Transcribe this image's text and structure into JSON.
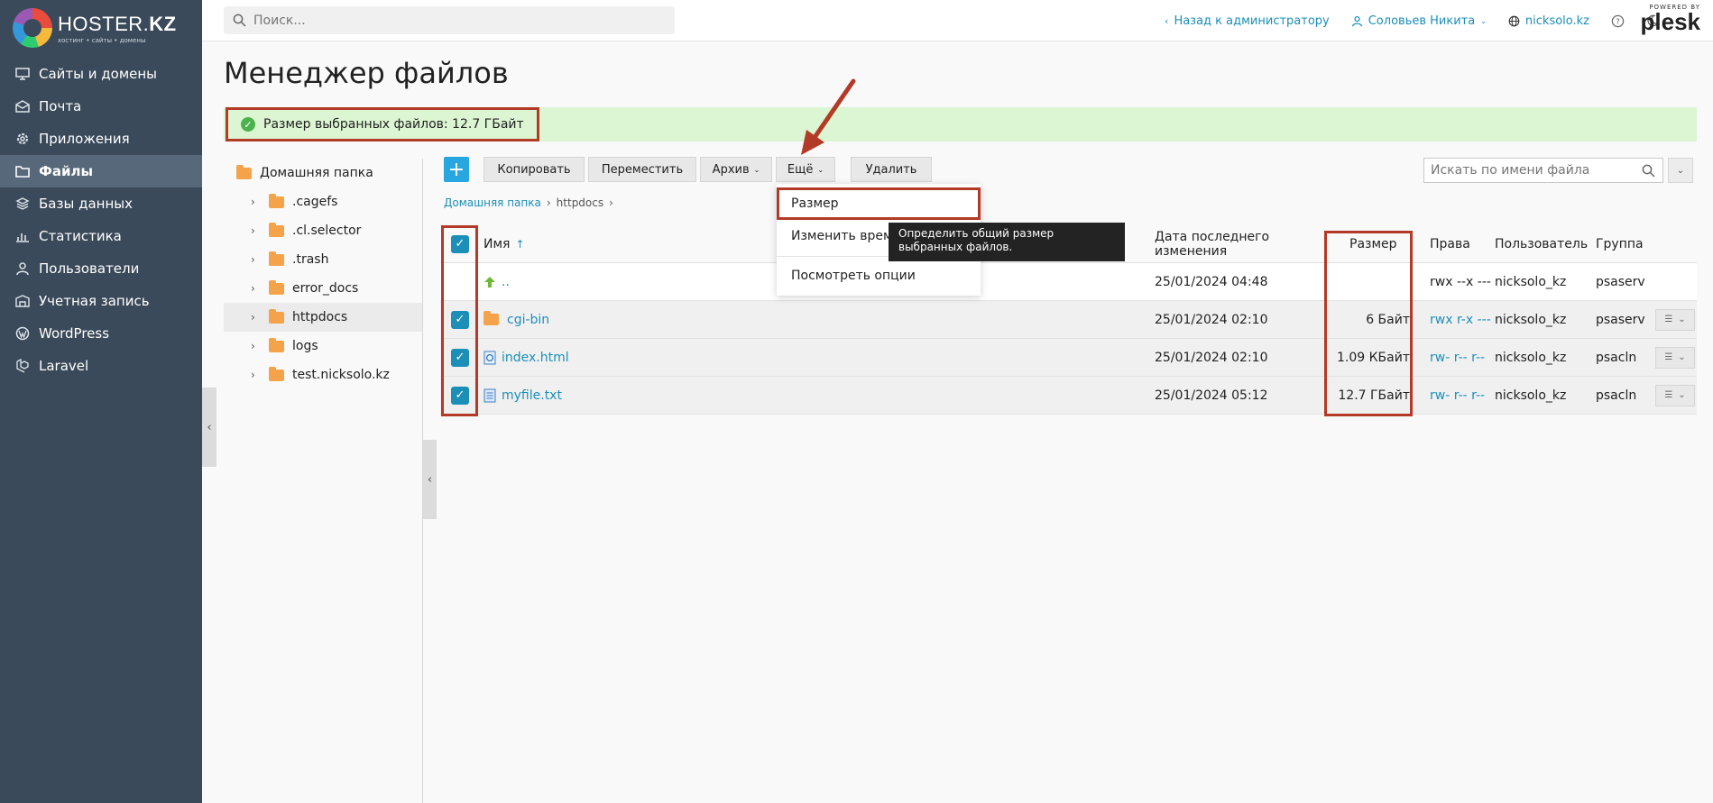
{
  "brand": {
    "logo_main": "HOSTER.",
    "logo_bold": "KZ",
    "logo_sub": "хостинг • сайты • домены"
  },
  "sidebar": {
    "items": [
      {
        "label": "Сайты и домены",
        "icon": "monitor-icon"
      },
      {
        "label": "Почта",
        "icon": "mail-icon"
      },
      {
        "label": "Приложения",
        "icon": "gear-icon"
      },
      {
        "label": "Файлы",
        "icon": "folder-icon",
        "active": true
      },
      {
        "label": "Базы данных",
        "icon": "database-icon"
      },
      {
        "label": "Статистика",
        "icon": "bar-chart-icon"
      },
      {
        "label": "Пользователи",
        "icon": "user-icon"
      },
      {
        "label": "Учетная запись",
        "icon": "account-icon"
      },
      {
        "label": "WordPress",
        "icon": "wordpress-icon"
      },
      {
        "label": "Laravel",
        "icon": "laravel-icon"
      }
    ]
  },
  "header": {
    "search_placeholder": "Поиск...",
    "back_link": "Назад к администратору",
    "user_name": "Соловьев Никита",
    "domain": "nicksolo.kz",
    "powered_by": "POWERED BY",
    "plesk": "plesk"
  },
  "page": {
    "title": "Менеджер файлов",
    "success_message": "Размер выбранных файлов: 12.7 ГБайт"
  },
  "tree": {
    "root": "Домашняя папка",
    "children": [
      ".cagefs",
      ".cl.selector",
      ".trash",
      "error_docs",
      "httpdocs",
      "logs",
      "test.nicksolo.kz"
    ],
    "selected": "httpdocs"
  },
  "toolbar": {
    "add": "+",
    "copy": "Копировать",
    "move": "Переместить",
    "archive": "Архив",
    "more": "Ещё",
    "delete": "Удалить",
    "file_search_placeholder": "Искать по имени файла"
  },
  "breadcrumb": {
    "home": "Домашняя папка",
    "current": "httpdocs"
  },
  "table": {
    "headers": {
      "name": "Имя",
      "date": "Дата последнего изменения",
      "size": "Размер",
      "perms": "Права",
      "user": "Пользователь",
      "group": "Группа"
    },
    "rows": [
      {
        "name": "..",
        "date": "25/01/2024 04:48",
        "size": "",
        "perms": "rwx --x ---",
        "user": "nicksolo_kz",
        "group": "psaserv"
      },
      {
        "name": "cgi-bin",
        "date": "25/01/2024 02:10",
        "size": "6 Байт",
        "perms": "rwx r-x ---",
        "user": "nicksolo_kz",
        "group": "psaserv"
      },
      {
        "name": "index.html",
        "date": "25/01/2024 02:10",
        "size": "1.09 КБайт",
        "perms": "rw- r-- r--",
        "user": "nicksolo_kz",
        "group": "psacln"
      },
      {
        "name": "myfile.txt",
        "date": "25/01/2024 05:12",
        "size": "12.7 ГБайт",
        "perms": "rw- r-- r--",
        "user": "nicksolo_kz",
        "group": "psacln"
      }
    ]
  },
  "dropdown": {
    "size": "Размер",
    "change_time": "Изменить врем",
    "view_options": "Посмотреть опции"
  },
  "tooltip": {
    "text": "Определить общий размер выбранных файлов."
  },
  "colors": {
    "sidebar_bg": "#3b4a5a",
    "accent": "#1c8fb8",
    "success_bg": "#dcf5d2",
    "highlight": "#b23a26"
  }
}
